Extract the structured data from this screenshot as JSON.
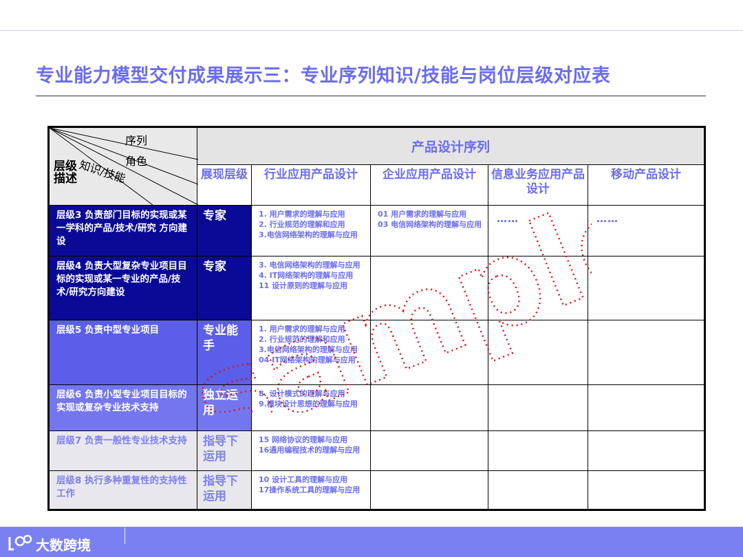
{
  "title": "专业能力模型交付成果展示三：专业序列知识/技能与岗位层级对应表",
  "corner": {
    "sequence": "序列",
    "role": "角色",
    "knowledge": "知识/技能",
    "level_desc": "层级描述"
  },
  "group_header": "产品设计序列",
  "columns": [
    "展现层级",
    "行业应用产品设计",
    "企业应用产品设计",
    "信息业务应用产品设计",
    "移动产品设计"
  ],
  "rows": [
    {
      "level": "层级3  负责部门目标的实现或某一学科的产品/技术/研究 方向建设",
      "role": "专家",
      "industry": [
        "1. 用户需求的理解与应用",
        "2. 行业规范的理解和应用",
        "3.电信网络架构的理解与应用"
      ],
      "enterprise": [
        "01 用户需求的理解与应用",
        "03 电信网络架构的理解与应用"
      ],
      "info": "……",
      "mobile": "……"
    },
    {
      "level": "层级4  负责大型复杂专业项目目标的实现或某一专业的产品/技术/研究方向建设",
      "role": "专家",
      "industry": [
        "3. 电信网络架构的理解与应用",
        "4. IT网络架构的理解与应用",
        "11 设计原则的理解与应用"
      ],
      "enterprise": [],
      "info": "",
      "mobile": ""
    },
    {
      "level": "层级5  负责中型专业项目",
      "role": "专业能手",
      "industry": [
        "1. 用户需求的理解与应用",
        "2. 行业规范的理解和应用",
        "3.电信网络架构的理解与应用",
        "04 IT网络架构的理解与应用"
      ],
      "enterprise": [],
      "info": "",
      "mobile": ""
    },
    {
      "level": "层级6  负责小型专业项目目标的实现或复杂专业技术支持",
      "role": "独立运用",
      "industry": [
        "8. 设计模式的理解与应用",
        "9.模块设计思想的理解与应用"
      ],
      "enterprise": [],
      "info": "",
      "mobile": ""
    },
    {
      "level": "层级7  负责一般性专业技术支持",
      "role": "指导下运用",
      "industry": [
        "15 网络协议的理解与应用",
        "16通用编程技术的理解与应用"
      ],
      "enterprise": [],
      "info": "",
      "mobile": ""
    },
    {
      "level": " 层级8 执行多种重复性的支持性工作",
      "role": "指导下运用",
      "industry": [
        "10 设计工具的理解与应用",
        "17操作系统工具的理解与应用"
      ],
      "enterprise": [],
      "info": "",
      "mobile": ""
    }
  ],
  "watermark": "sample",
  "footer": {
    "brand": "大数跨境"
  },
  "colors": {
    "accent": "#6a6cf0",
    "level_dark": "#0a0a96",
    "level_mid": "#5b5ee8",
    "level_light": "#7476ef",
    "level_pale": "#e8e8ec",
    "footer_bar": "#7b80f1",
    "watermark": "#dd1111"
  }
}
